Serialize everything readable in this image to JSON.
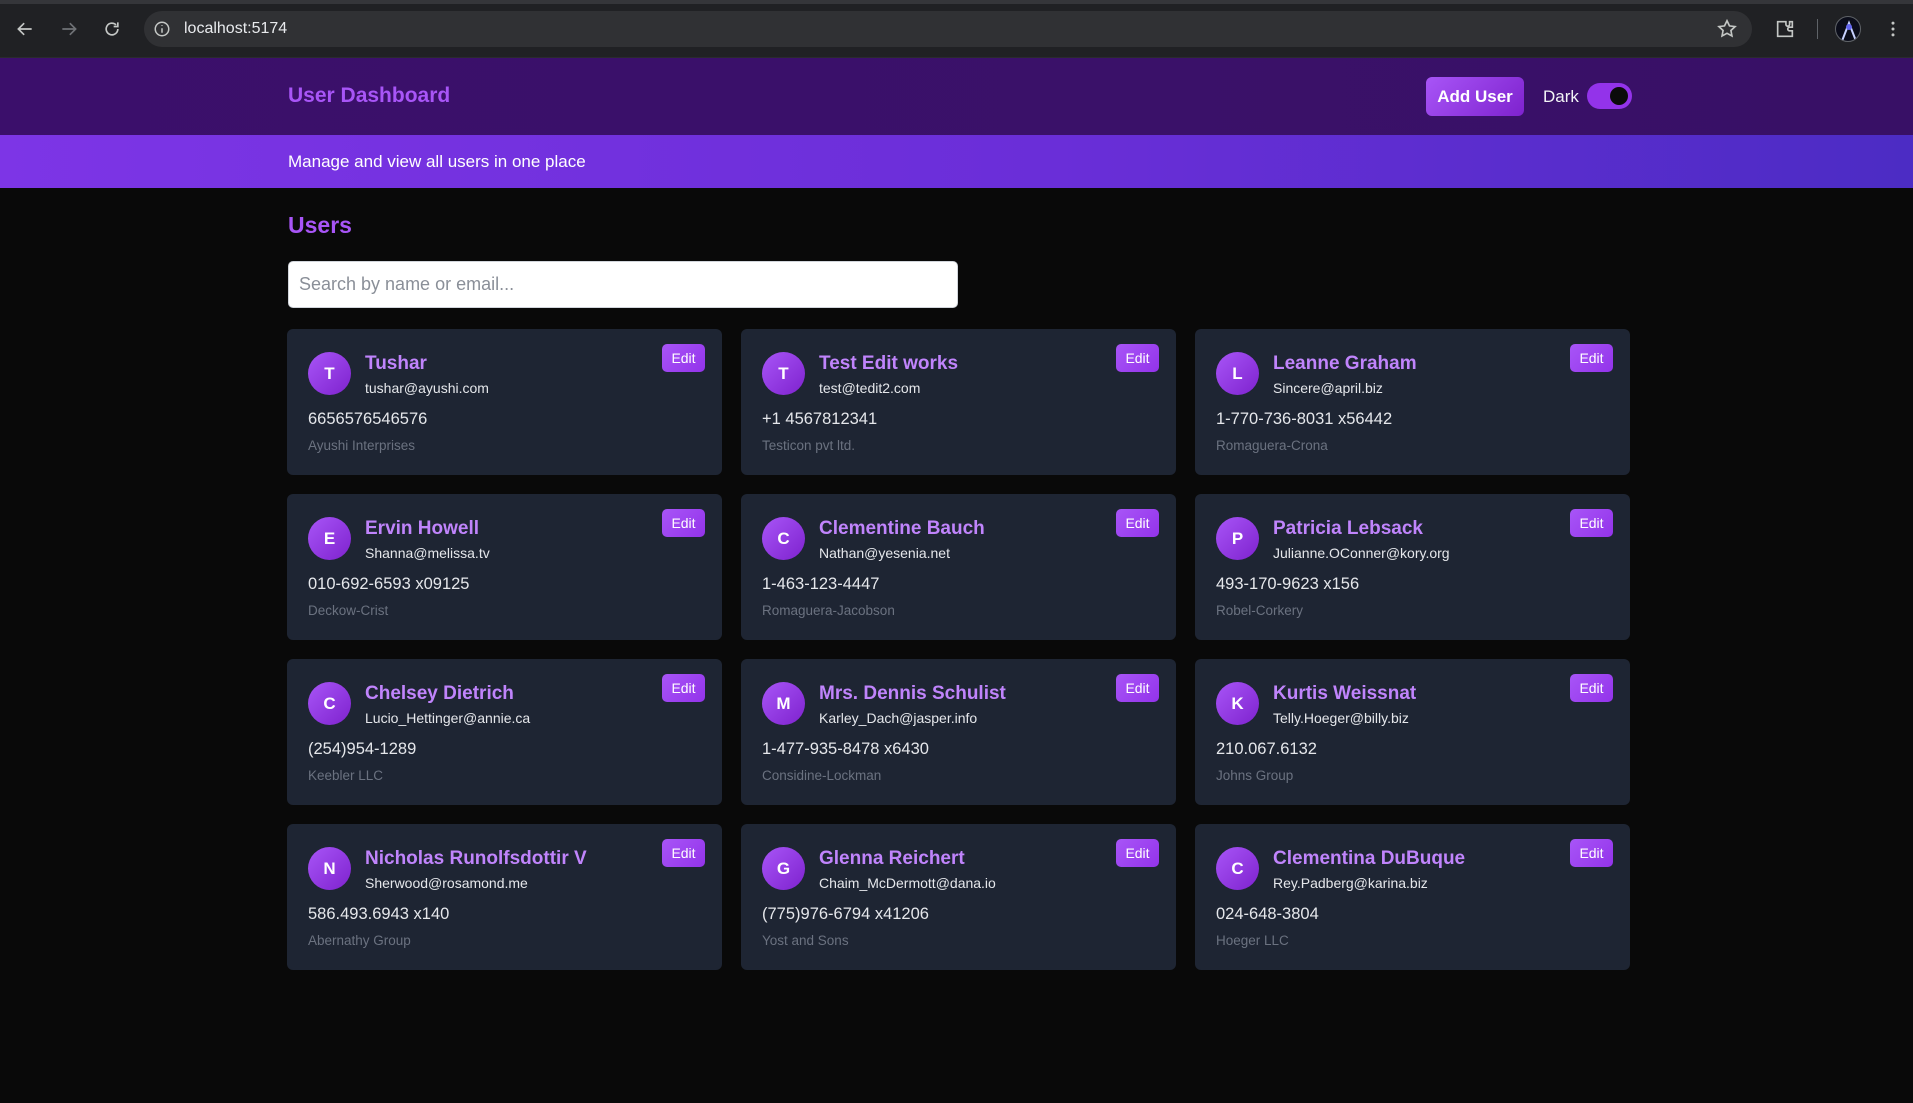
{
  "browser": {
    "url": "localhost:5174"
  },
  "header": {
    "title": "User Dashboard",
    "add_user_label": "Add User",
    "theme_label": "Dark",
    "theme_dark_on": true
  },
  "subheader": {
    "text": "Manage and view all users in one place"
  },
  "main": {
    "section_title": "Users",
    "search_placeholder": "Search by name or email...",
    "edit_label": "Edit"
  },
  "users": [
    {
      "initial": "T",
      "name": "Tushar",
      "email": "tushar@ayushi.com",
      "phone": "6656576546576",
      "company": "Ayushi Interprises"
    },
    {
      "initial": "T",
      "name": "Test Edit works",
      "email": "test@tedit2.com",
      "phone": "+1 4567812341",
      "company": "Testicon pvt ltd."
    },
    {
      "initial": "L",
      "name": "Leanne Graham",
      "email": "Sincere@april.biz",
      "phone": "1-770-736-8031 x56442",
      "company": "Romaguera-Crona"
    },
    {
      "initial": "E",
      "name": "Ervin Howell",
      "email": "Shanna@melissa.tv",
      "phone": "010-692-6593 x09125",
      "company": "Deckow-Crist"
    },
    {
      "initial": "C",
      "name": "Clementine Bauch",
      "email": "Nathan@yesenia.net",
      "phone": "1-463-123-4447",
      "company": "Romaguera-Jacobson"
    },
    {
      "initial": "P",
      "name": "Patricia Lebsack",
      "email": "Julianne.OConner@kory.org",
      "phone": "493-170-9623 x156",
      "company": "Robel-Corkery"
    },
    {
      "initial": "C",
      "name": "Chelsey Dietrich",
      "email": "Lucio_Hettinger@annie.ca",
      "phone": "(254)954-1289",
      "company": "Keebler LLC"
    },
    {
      "initial": "M",
      "name": "Mrs. Dennis Schulist",
      "email": "Karley_Dach@jasper.info",
      "phone": "1-477-935-8478 x6430",
      "company": "Considine-Lockman"
    },
    {
      "initial": "K",
      "name": "Kurtis Weissnat",
      "email": "Telly.Hoeger@billy.biz",
      "phone": "210.067.6132",
      "company": "Johns Group"
    },
    {
      "initial": "N",
      "name": "Nicholas Runolfsdottir V",
      "email": "Sherwood@rosamond.me",
      "phone": "586.493.6943 x140",
      "company": "Abernathy Group"
    },
    {
      "initial": "G",
      "name": "Glenna Reichert",
      "email": "Chaim_McDermott@dana.io",
      "phone": "(775)976-6794 x41206",
      "company": "Yost and Sons"
    },
    {
      "initial": "C",
      "name": "Clementina DuBuque",
      "email": "Rey.Padberg@karina.biz",
      "phone": "024-648-3804",
      "company": "Hoeger LLC"
    }
  ],
  "colors": {
    "accent": "#a855f7",
    "header_bg": "#3b0f6b",
    "subheader_bg": "#7d35e6",
    "card_bg": "#1e2533",
    "page_bg": "#090909"
  }
}
